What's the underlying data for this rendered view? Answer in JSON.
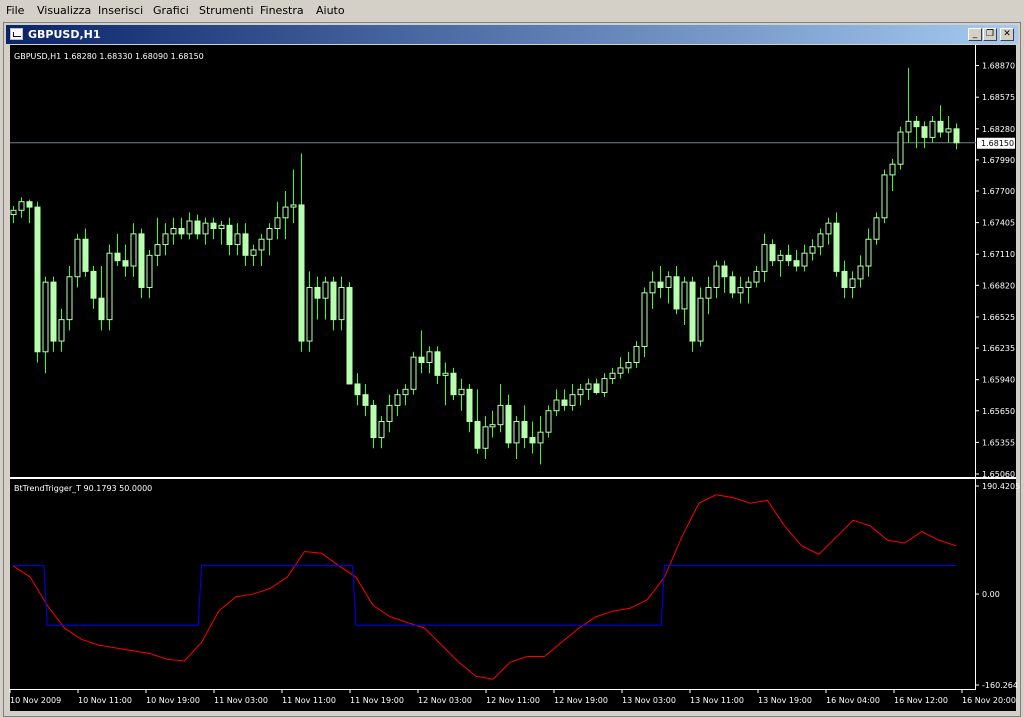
{
  "menu": [
    "File",
    "Visualizza",
    "Inserisci",
    "Grafici",
    "Strumenti",
    "Finestra",
    "Aiuto"
  ],
  "window": {
    "title": "GBPUSD,H1",
    "buttons": [
      "minimize",
      "restore",
      "close"
    ]
  },
  "price_panel": {
    "header": "GBPUSD,H1  1.68280 1.68330 1.68090 1.68150",
    "current_price_label": "1.68150",
    "current_price": 1.6815,
    "price_ticks": [
      "1.68870",
      "1.68575",
      "1.68280",
      "1.67990",
      "1.67700",
      "1.67405",
      "1.67110",
      "1.66820",
      "1.66525",
      "1.66235",
      "1.65940",
      "1.65650",
      "1.65355",
      "1.65060"
    ],
    "colors": {
      "background": "#000000",
      "candle": "#b8ffb0",
      "wick": "#39ff14",
      "grid_line": "#708090",
      "axis_text": "#ffffff"
    }
  },
  "indicator_panel": {
    "header": "BtTrendTrigger_T 90.1793 50.0000",
    "ticks": [
      "190.4205",
      "0.00",
      "-160.264"
    ],
    "colors": {
      "trend_line": "#ff0000",
      "trigger_line": "#0000ff"
    }
  },
  "time_axis": [
    "10 Nov 2009",
    "10 Nov 11:00",
    "10 Nov 19:00",
    "11 Nov 03:00",
    "11 Nov 11:00",
    "11 Nov 19:00",
    "12 Nov 03:00",
    "12 Nov 11:00",
    "12 Nov 19:00",
    "13 Nov 03:00",
    "13 Nov 11:00",
    "13 Nov 19:00",
    "16 Nov 04:00",
    "16 Nov 12:00",
    "16 Nov 20:00"
  ],
  "chart_data": [
    {
      "type": "candlestick",
      "title": "GBPUSD,H1",
      "ylim": [
        1.6506,
        1.6895
      ],
      "series": [
        {
          "name": "GBPUSD",
          "ohlc": [
            [
              1.6748,
              1.6756,
              1.674,
              1.6752
            ],
            [
              1.6752,
              1.6764,
              1.6745,
              1.676
            ],
            [
              1.676,
              1.6762,
              1.674,
              1.6755
            ],
            [
              1.6755,
              1.676,
              1.661,
              1.662
            ],
            [
              1.662,
              1.669,
              1.66,
              1.6685
            ],
            [
              1.6685,
              1.669,
              1.662,
              1.663
            ],
            [
              1.663,
              1.666,
              1.662,
              1.665
            ],
            [
              1.665,
              1.67,
              1.664,
              1.669
            ],
            [
              1.669,
              1.673,
              1.668,
              1.6725
            ],
            [
              1.6725,
              1.6735,
              1.669,
              1.6695
            ],
            [
              1.6695,
              1.67,
              1.666,
              1.667
            ],
            [
              1.667,
              1.67,
              1.664,
              1.665
            ],
            [
              1.665,
              1.672,
              1.664,
              1.6712
            ],
            [
              1.6712,
              1.673,
              1.67,
              1.6705
            ],
            [
              1.6705,
              1.672,
              1.669,
              1.67
            ],
            [
              1.67,
              1.674,
              1.669,
              1.673
            ],
            [
              1.673,
              1.6735,
              1.667,
              1.668
            ],
            [
              1.668,
              1.6715,
              1.667,
              1.671
            ],
            [
              1.671,
              1.6745,
              1.67,
              1.672
            ],
            [
              1.672,
              1.674,
              1.671,
              1.673
            ],
            [
              1.673,
              1.6745,
              1.672,
              1.6735
            ],
            [
              1.6735,
              1.6745,
              1.6725,
              1.673
            ],
            [
              1.673,
              1.675,
              1.6725,
              1.6742
            ],
            [
              1.6742,
              1.6748,
              1.6725,
              1.673
            ],
            [
              1.673,
              1.6745,
              1.672,
              1.674
            ],
            [
              1.674,
              1.6745,
              1.6725,
              1.6735
            ],
            [
              1.6735,
              1.6742,
              1.672,
              1.6738
            ],
            [
              1.6738,
              1.6745,
              1.671,
              1.672
            ],
            [
              1.672,
              1.674,
              1.671,
              1.673
            ],
            [
              1.673,
              1.674,
              1.67,
              1.671
            ],
            [
              1.671,
              1.672,
              1.67,
              1.6715
            ],
            [
              1.6715,
              1.673,
              1.67,
              1.6725
            ],
            [
              1.6725,
              1.674,
              1.671,
              1.6735
            ],
            [
              1.6735,
              1.676,
              1.6725,
              1.6745
            ],
            [
              1.6745,
              1.677,
              1.6725,
              1.6755
            ],
            [
              1.6755,
              1.679,
              1.674,
              1.6757
            ],
            [
              1.6757,
              1.6805,
              1.662,
              1.663
            ],
            [
              1.663,
              1.6695,
              1.662,
              1.668
            ],
            [
              1.668,
              1.669,
              1.665,
              1.667
            ],
            [
              1.667,
              1.669,
              1.665,
              1.6685
            ],
            [
              1.6685,
              1.669,
              1.664,
              1.665
            ],
            [
              1.665,
              1.669,
              1.664,
              1.668
            ],
            [
              1.668,
              1.6685,
              1.659,
              1.659
            ],
            [
              1.659,
              1.66,
              1.657,
              1.658
            ],
            [
              1.658,
              1.659,
              1.656,
              1.657
            ],
            [
              1.657,
              1.6575,
              1.653,
              1.654
            ],
            [
              1.654,
              1.656,
              1.653,
              1.6555
            ],
            [
              1.6555,
              1.658,
              1.6545,
              1.657
            ],
            [
              1.657,
              1.6585,
              1.656,
              1.658
            ],
            [
              1.658,
              1.659,
              1.657,
              1.6585
            ],
            [
              1.6585,
              1.662,
              1.658,
              1.6615
            ],
            [
              1.6615,
              1.664,
              1.66,
              1.661
            ],
            [
              1.661,
              1.6625,
              1.66,
              1.662
            ],
            [
              1.662,
              1.6625,
              1.659,
              1.6598
            ],
            [
              1.6598,
              1.661,
              1.657,
              1.66
            ],
            [
              1.66,
              1.6605,
              1.6575,
              1.658
            ],
            [
              1.658,
              1.6595,
              1.6565,
              1.6585
            ],
            [
              1.6585,
              1.659,
              1.6545,
              1.6555
            ],
            [
              1.6555,
              1.6585,
              1.6525,
              1.653
            ],
            [
              1.653,
              1.656,
              1.652,
              1.655
            ],
            [
              1.655,
              1.6565,
              1.654,
              1.6552
            ],
            [
              1.6552,
              1.659,
              1.6545,
              1.657
            ],
            [
              1.657,
              1.658,
              1.653,
              1.6535
            ],
            [
              1.6535,
              1.656,
              1.652,
              1.6555
            ],
            [
              1.6555,
              1.657,
              1.653,
              1.654
            ],
            [
              1.654,
              1.6555,
              1.6525,
              1.6535
            ],
            [
              1.6535,
              1.656,
              1.6515,
              1.6545
            ],
            [
              1.6545,
              1.657,
              1.654,
              1.6565
            ],
            [
              1.6565,
              1.6585,
              1.656,
              1.6575
            ],
            [
              1.6575,
              1.6585,
              1.6565,
              1.657
            ],
            [
              1.657,
              1.659,
              1.6565,
              1.658
            ],
            [
              1.658,
              1.659,
              1.657,
              1.6585
            ],
            [
              1.6585,
              1.6595,
              1.6575,
              1.659
            ],
            [
              1.659,
              1.6595,
              1.658,
              1.6582
            ],
            [
              1.6582,
              1.66,
              1.6578,
              1.6595
            ],
            [
              1.6595,
              1.6605,
              1.659,
              1.66
            ],
            [
              1.66,
              1.6615,
              1.6595,
              1.6605
            ],
            [
              1.6605,
              1.662,
              1.66,
              1.661
            ],
            [
              1.661,
              1.663,
              1.6605,
              1.6625
            ],
            [
              1.6625,
              1.668,
              1.6615,
              1.6675
            ],
            [
              1.6675,
              1.6695,
              1.666,
              1.6685
            ],
            [
              1.6685,
              1.67,
              1.667,
              1.668
            ],
            [
              1.668,
              1.6695,
              1.6665,
              1.669
            ],
            [
              1.669,
              1.67,
              1.6655,
              1.666
            ],
            [
              1.666,
              1.669,
              1.6645,
              1.6685
            ],
            [
              1.6685,
              1.669,
              1.662,
              1.663
            ],
            [
              1.663,
              1.668,
              1.6625,
              1.667
            ],
            [
              1.667,
              1.669,
              1.6655,
              1.668
            ],
            [
              1.668,
              1.6705,
              1.667,
              1.67
            ],
            [
              1.67,
              1.6705,
              1.6675,
              1.669
            ],
            [
              1.669,
              1.6695,
              1.667,
              1.6675
            ],
            [
              1.6675,
              1.669,
              1.6665,
              1.668
            ],
            [
              1.668,
              1.669,
              1.6665,
              1.6685
            ],
            [
              1.6685,
              1.67,
              1.668,
              1.6695
            ],
            [
              1.6695,
              1.673,
              1.6685,
              1.672
            ],
            [
              1.672,
              1.6725,
              1.67,
              1.6705
            ],
            [
              1.6705,
              1.6715,
              1.669,
              1.671
            ],
            [
              1.671,
              1.672,
              1.67,
              1.6705
            ],
            [
              1.6705,
              1.6715,
              1.6695,
              1.67
            ],
            [
              1.67,
              1.672,
              1.6695,
              1.6712
            ],
            [
              1.6712,
              1.6725,
              1.6705,
              1.6718
            ],
            [
              1.6718,
              1.6735,
              1.671,
              1.673
            ],
            [
              1.673,
              1.6745,
              1.672,
              1.674
            ],
            [
              1.674,
              1.675,
              1.669,
              1.6695
            ],
            [
              1.6695,
              1.6705,
              1.667,
              1.668
            ],
            [
              1.668,
              1.6695,
              1.667,
              1.6688
            ],
            [
              1.6688,
              1.671,
              1.668,
              1.67
            ],
            [
              1.67,
              1.6735,
              1.669,
              1.6725
            ],
            [
              1.6725,
              1.675,
              1.672,
              1.6745
            ],
            [
              1.6745,
              1.679,
              1.674,
              1.6785
            ],
            [
              1.6785,
              1.68,
              1.677,
              1.6795
            ],
            [
              1.6795,
              1.683,
              1.679,
              1.6825
            ],
            [
              1.6825,
              1.6885,
              1.6815,
              1.6835
            ],
            [
              1.6835,
              1.684,
              1.681,
              1.683
            ],
            [
              1.683,
              1.6835,
              1.681,
              1.682
            ],
            [
              1.682,
              1.684,
              1.6815,
              1.6835
            ],
            [
              1.6835,
              1.685,
              1.682,
              1.6825
            ],
            [
              1.6825,
              1.684,
              1.6815,
              1.6828
            ],
            [
              1.6828,
              1.6833,
              1.6809,
              1.6815
            ]
          ]
        }
      ]
    },
    {
      "type": "line",
      "title": "BtTrendTrigger_T",
      "ylim": [
        -160.264,
        190.4205
      ],
      "series": [
        {
          "name": "BtTrendTrigger_T",
          "values": [
            50,
            30,
            -20,
            -60,
            -80,
            -90,
            -95,
            -100,
            -105,
            -115,
            -118,
            -85,
            -30,
            -5,
            0,
            10,
            30,
            75,
            72,
            50,
            30,
            -20,
            -40,
            -50,
            -60,
            -90,
            -120,
            -145,
            -150,
            -120,
            -110,
            -110,
            -85,
            -60,
            -40,
            -30,
            -25,
            -10,
            30,
            100,
            160,
            175,
            170,
            160,
            165,
            120,
            85,
            70,
            100,
            130,
            120,
            95,
            90,
            110,
            95,
            85
          ]
        },
        {
          "name": "trigger",
          "values": [
            50,
            50,
            -55,
            -55,
            -55,
            -55,
            -55,
            -55,
            -55,
            -55,
            -55,
            50,
            50,
            50,
            50,
            50,
            50,
            50,
            50,
            50,
            -55,
            -55,
            -55,
            -55,
            -55,
            -55,
            -55,
            -55,
            -55,
            -55,
            -55,
            -55,
            -55,
            -55,
            -55,
            -55,
            -55,
            -55,
            50,
            50,
            50,
            50,
            50,
            50,
            50,
            50,
            50,
            50,
            50,
            50,
            50,
            50,
            50,
            50,
            50,
            50
          ]
        }
      ]
    }
  ]
}
